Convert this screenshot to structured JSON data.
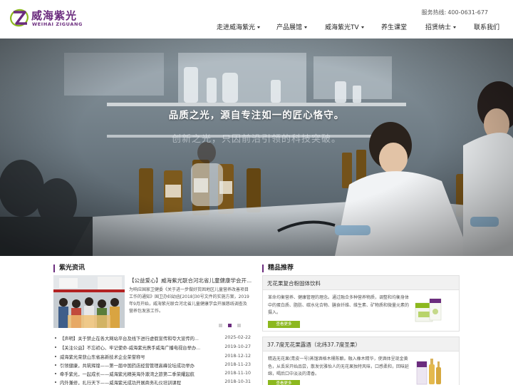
{
  "header": {
    "brand_cn": "威海紫光",
    "brand_en": "WEIHAI ZIGUANG",
    "hotline_label": "服务热线:",
    "hotline_number": "400-0631-677",
    "nav": [
      {
        "label": "走进威海紫光",
        "dropdown": true
      },
      {
        "label": "产品展馆",
        "dropdown": true
      },
      {
        "label": "威海紫光TV",
        "dropdown": true
      },
      {
        "label": "养生课堂",
        "dropdown": false
      },
      {
        "label": "招贤纳士",
        "dropdown": true
      },
      {
        "label": "联系我们",
        "dropdown": false
      }
    ]
  },
  "banner": {
    "title": "品质之光，源自专注如一的匠心恪守。",
    "subtitle": "创新之光，只因前沿引领的科技突破。"
  },
  "news": {
    "heading": "紫光资讯",
    "feature_title": "【公益爱心】威海紫光联合河北省儿童健康学会开...",
    "feature_desc": "为响应国家卫健委《关于进一步做好贫困地区儿童营养改善项目工作的通知》国卫办妇幼函[2018]30号文件的实施方案，2019年9月开始，威海紫光联合河北省儿童健康学会开展慈线调查及营养包发放工作。",
    "slide_count": 3,
    "active_slide": 1,
    "items": [
      {
        "title": "【声明】关于禁止在各大网站平台及线下进行虚假宣传和夸大宣传的...",
        "date": "2025-02-22"
      },
      {
        "title": "【关注公益】不忘初心、牢记使命-威海紫光携手威海广播电视台举办...",
        "date": "2019-10-27"
      },
      {
        "title": "威海紫光荣获山东省高新技术企业荣誉称号",
        "date": "2018-12-12"
      },
      {
        "title": "引领健康，共筑辉煌——第一届中国药店经营管理高峰论坛成功举办",
        "date": "2018-11-23"
      },
      {
        "title": "牵手紫光，一起成长——威海紫光精英海外漱湾之旅第二季荣耀起航",
        "date": "2018-11-10"
      },
      {
        "title": "内外兼修，扎行天下——威海紫光成功开展商务礼仪培训课程",
        "date": "2018-10-31"
      }
    ]
  },
  "products": {
    "heading": "精品推荐",
    "more_label": "查看更多",
    "items": [
      {
        "name": "无花果复合粉固体饮料",
        "desc": "革命均衡营养、健康管理的理念。通过融合多种营养物质，调整和均衡身体中的蛋白质、脂肪、碳水化合物、膳食纤维、维生素、矿物质和微量元素的摄入。"
      },
      {
        "name": "37.7度无花果露酒（北纬37.7度圣果）",
        "desc": "精选无花果(青皮一号)蒸馏酒格木桶陈酿。融入橡木精华，使酒体呈现金黄色，从丢采开始品尝，散发优雅怡人的无花果独特风味，口感柔和，回味延绵，喝后口中淡淡的清香。"
      }
    ]
  },
  "colors": {
    "brand_purple": "#6b2c7e",
    "button_green": "#8cb81e",
    "active_dot": "#6b2c7e"
  }
}
